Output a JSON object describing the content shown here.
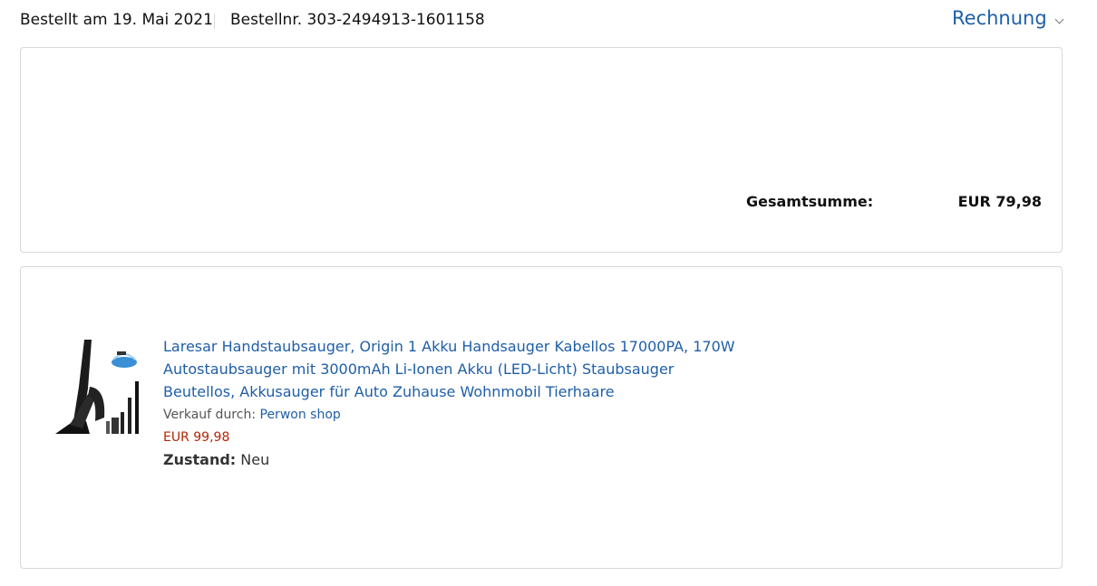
{
  "header": {
    "order_date": "Bestellt am 19. Mai 2021",
    "order_number": "Bestellnr. 303-2494913-1601158",
    "invoice_label": "Rechnung"
  },
  "summary": {
    "total_label": "Gesamtsumme:",
    "total_value": "EUR 79,98"
  },
  "item": {
    "title": "Laresar Handstaubsauger, Origin 1 Akku Handsauger Kabellos 17000PA, 170W Autostaubsauger mit 3000mAh Li-Ionen Akku (LED-Licht) Staubsauger Beutellos, Akkusauger für Auto Zuhause Wohnmobil Tierhaare",
    "sold_by_label": "Verkauf durch:",
    "seller": "Perwon shop",
    "price": "EUR 99,98",
    "condition_label": "Zustand:",
    "condition_value": "Neu",
    "image_icon": "handheld-vacuum-product-image"
  },
  "colors": {
    "link": "#1f5fa8",
    "price": "#b12704",
    "border": "#d5d9d9"
  }
}
